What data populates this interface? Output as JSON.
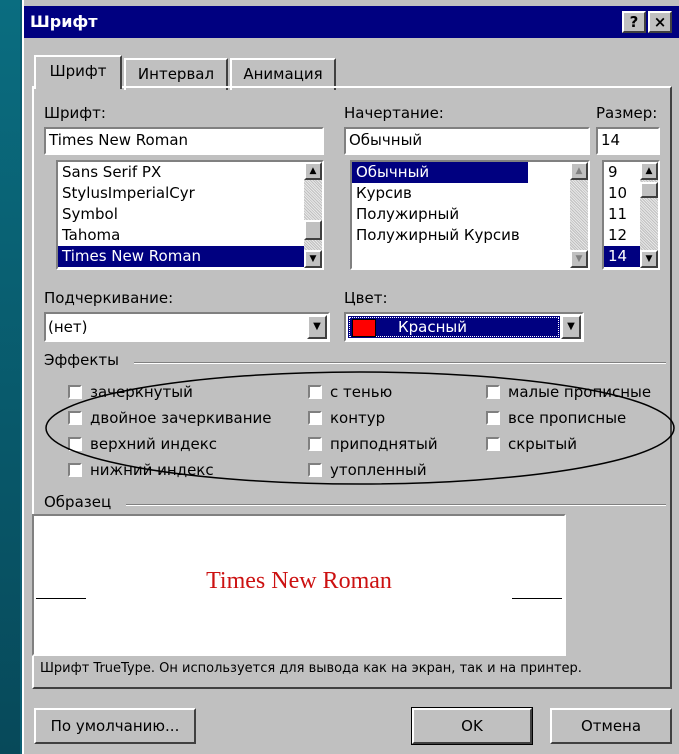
{
  "window": {
    "title": "Шрифт",
    "help_btn": "?",
    "close_btn": "×"
  },
  "tabs": [
    "Шрифт",
    "Интервал",
    "Анимация"
  ],
  "font": {
    "label": "Шрифт:",
    "value": "Times New Roman",
    "items": [
      "Sans Serif PX",
      "StylusImperialCyr",
      "Symbol",
      "Tahoma",
      "Times New Roman"
    ],
    "selected": "Times New Roman"
  },
  "style": {
    "label": "Начертание:",
    "value": "Обычный",
    "items": [
      "Обычный",
      "Курсив",
      "Полужирный",
      "Полужирный Курсив"
    ],
    "selected": "Обычный"
  },
  "size": {
    "label": "Размер:",
    "value": "14",
    "items": [
      "9",
      "10",
      "11",
      "12",
      "14"
    ],
    "selected": "14"
  },
  "underline": {
    "label": "Подчеркивание:",
    "value": "(нет)"
  },
  "color": {
    "label": "Цвет:",
    "value": "Красный",
    "swatch": "#ff0000"
  },
  "effects": {
    "label": "Эффекты",
    "items": [
      "зачеркнутый",
      "двойное зачеркивание",
      "верхний индекс",
      "нижний индекс",
      "с тенью",
      "контур",
      "приподнятый",
      "утопленный",
      "малые прописные",
      "все прописные",
      "скрытый"
    ]
  },
  "preview": {
    "label": "Образец",
    "text": "Times New Roman",
    "text_color": "#cc1111"
  },
  "info_text": "Шрифт TrueType. Он используется для вывода как на экран, так и на принтер.",
  "buttons": {
    "default": "По умолчанию...",
    "ok": "OK",
    "cancel": "Отмена"
  }
}
